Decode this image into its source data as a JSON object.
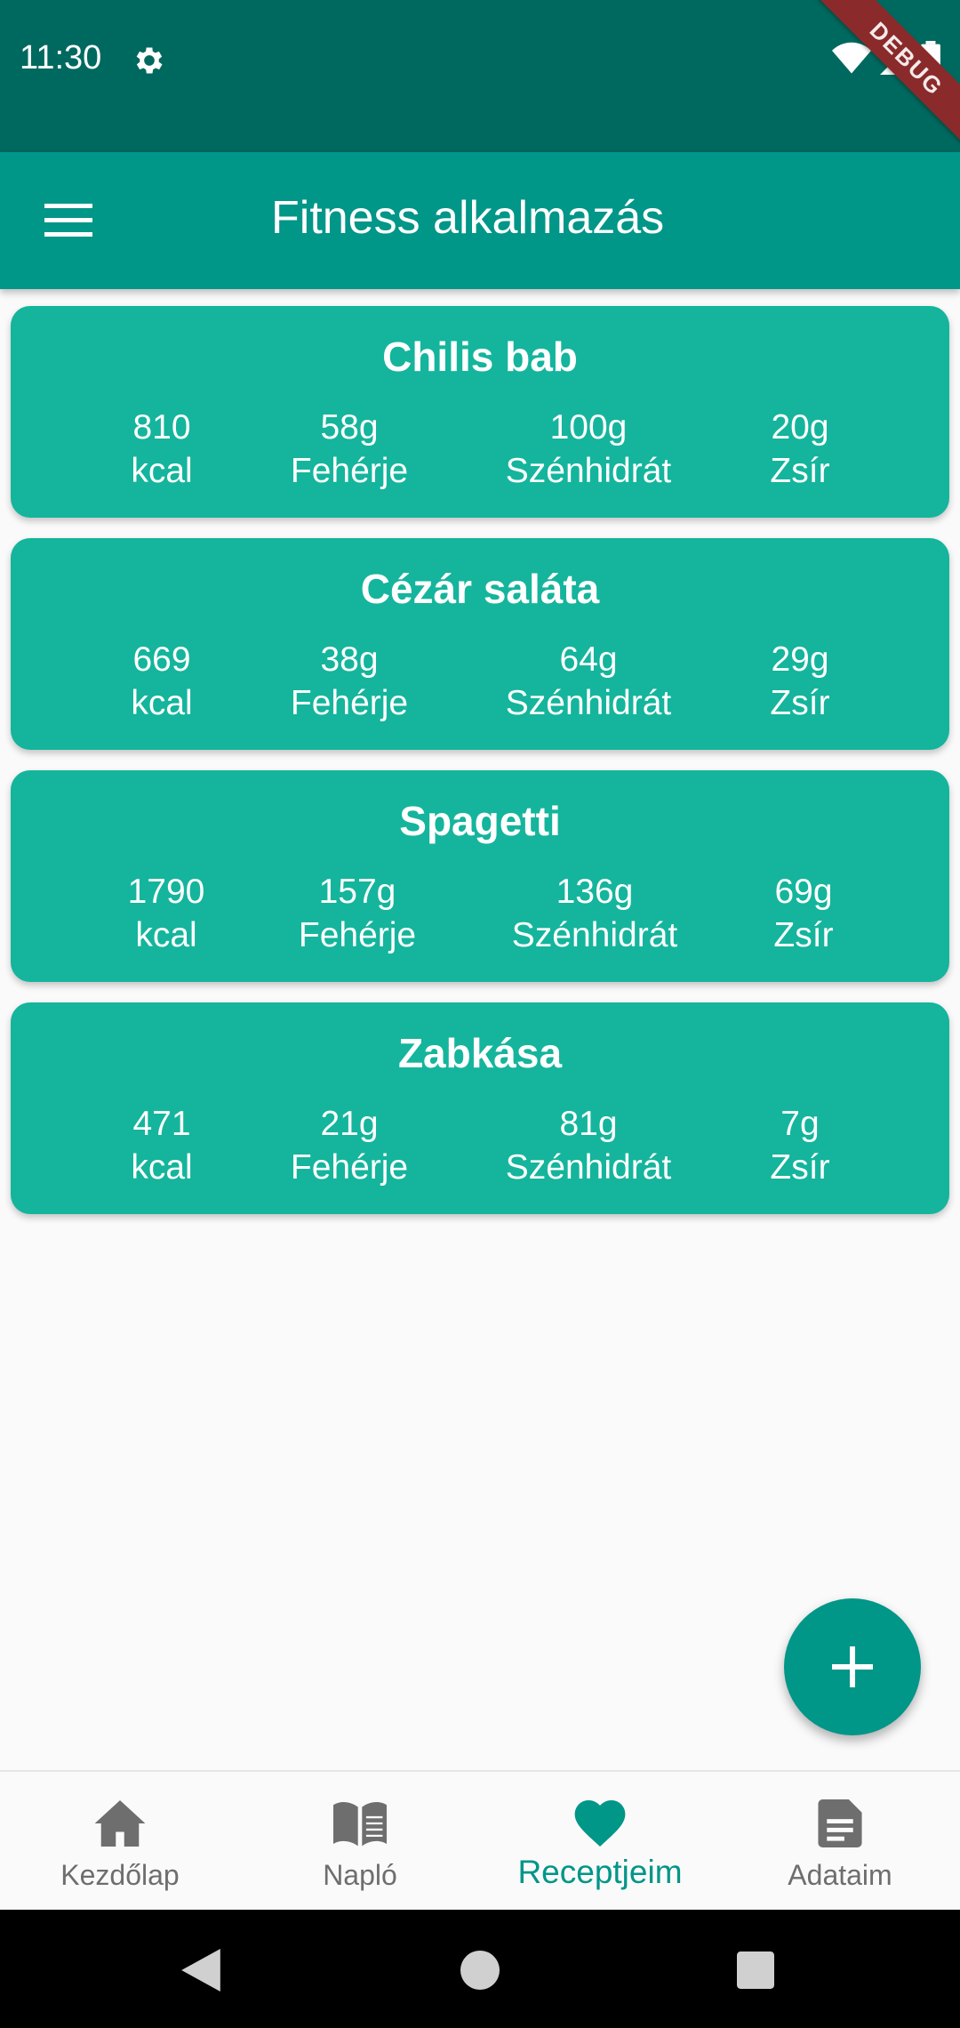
{
  "status_bar": {
    "time": "11:30",
    "debug_label": "DEBUG"
  },
  "app_bar": {
    "title": "Fitness alkalmazás"
  },
  "recipes": [
    {
      "name": "Chilis bab",
      "kcal": "810",
      "protein": "58g",
      "carbs": "100g",
      "fat": "20g"
    },
    {
      "name": "Cézár saláta",
      "kcal": "669",
      "protein": "38g",
      "carbs": "64g",
      "fat": "29g"
    },
    {
      "name": "Spagetti",
      "kcal": "1790",
      "protein": "157g",
      "carbs": "136g",
      "fat": "69g"
    },
    {
      "name": "Zabkása",
      "kcal": "471",
      "protein": "21g",
      "carbs": "81g",
      "fat": "7g"
    }
  ],
  "units": {
    "kcal": "kcal",
    "protein": "Fehérje",
    "carbs": "Szénhidrát",
    "fat": "Zsír"
  },
  "fab_icon": "plus-icon",
  "bottom_nav": {
    "items": [
      {
        "label": "Kezdőlap",
        "icon": "home-icon",
        "active": false
      },
      {
        "label": "Napló",
        "icon": "book-icon",
        "active": false
      },
      {
        "label": "Receptjeim",
        "icon": "heart-icon",
        "active": true
      },
      {
        "label": "Adataim",
        "icon": "document-icon",
        "active": false
      }
    ]
  },
  "colors": {
    "status_bar": "#00695f",
    "app_bar": "#009688",
    "card": "#14b59c",
    "active_nav": "#009688",
    "inactive_nav": "#6e6e6e"
  }
}
